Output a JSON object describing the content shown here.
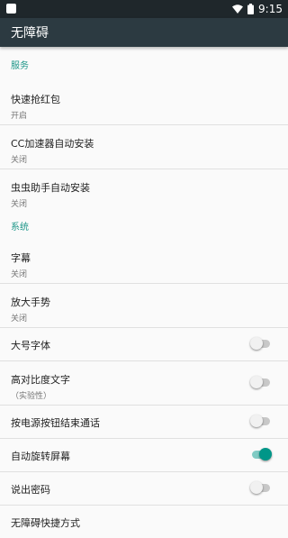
{
  "status_bar": {
    "time": "9:15",
    "wifi_icon": "wifi-icon",
    "battery_icon": "battery-icon"
  },
  "app_bar": {
    "title": "无障碍"
  },
  "sections": {
    "services": {
      "header": "服务",
      "items": [
        {
          "title": "快速抢红包",
          "summary": "开启"
        },
        {
          "title": "CC加速器自动安装",
          "summary": "关闭"
        },
        {
          "title": "虫虫助手自动安装",
          "summary": "关闭"
        }
      ]
    },
    "system": {
      "header": "系统",
      "items": [
        {
          "title": "字幕",
          "summary": "关闭"
        },
        {
          "title": "放大手势",
          "summary": "关闭"
        },
        {
          "title": "大号字体",
          "toggle": false
        },
        {
          "title": "高对比度文字",
          "summary": "（实验性）",
          "toggle": false
        },
        {
          "title": "按电源按钮结束通话",
          "toggle": false
        },
        {
          "title": "自动旋转屏幕",
          "toggle": true
        },
        {
          "title": "说出密码",
          "toggle": false
        },
        {
          "title": "无障碍快捷方式"
        }
      ]
    }
  },
  "colors": {
    "accent": "#009688",
    "app_bar": "#2c3a41",
    "status_bar": "#1f272b"
  }
}
